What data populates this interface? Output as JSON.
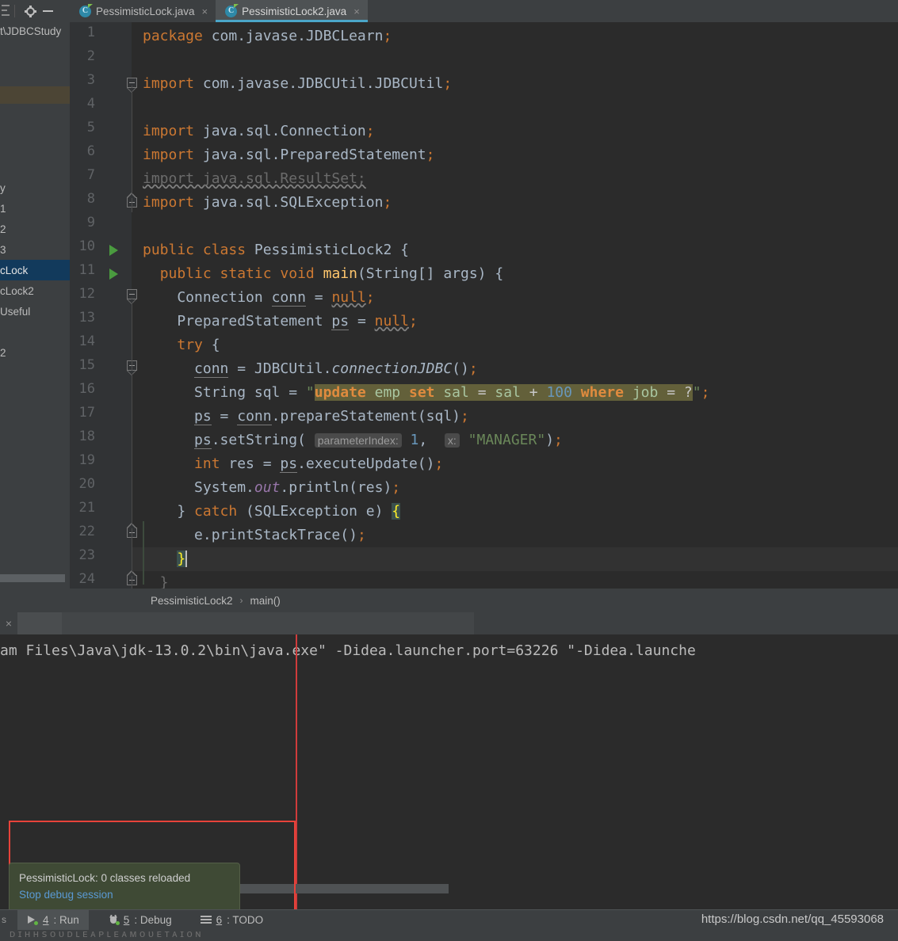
{
  "window": {
    "toolbar_icons": [
      "layout-icon",
      "gear-icon",
      "minimize-icon"
    ]
  },
  "tabs": [
    {
      "label": "PessimisticLock.java",
      "icon": "java-class-icon",
      "close": "×",
      "active": false
    },
    {
      "label": "PessimisticLock2.java",
      "icon": "java-class-icon",
      "close": "×",
      "active": true
    }
  ],
  "sidebar": {
    "path": "t\\JDBCStudy",
    "items": [
      {
        "label": "y",
        "selected": false
      },
      {
        "label": "1",
        "selected": false
      },
      {
        "label": "2",
        "selected": false
      },
      {
        "label": "3",
        "selected": false
      },
      {
        "label": "cLock",
        "selected": true
      },
      {
        "label": "cLock2",
        "selected": false
      },
      {
        "label": "Useful",
        "selected": false
      },
      {
        "label": "2",
        "selected": false
      }
    ]
  },
  "editor": {
    "caret_line": 23,
    "run_marker_lines": [
      10,
      11
    ],
    "lines": [
      {
        "n": 1,
        "text": "package com.javase.JDBCLearn;"
      },
      {
        "n": 2,
        "text": ""
      },
      {
        "n": 3,
        "text": "import com.javase.JDBCUtil.JDBCUtil;"
      },
      {
        "n": 4,
        "text": ""
      },
      {
        "n": 5,
        "text": "import java.sql.Connection;"
      },
      {
        "n": 6,
        "text": "import java.sql.PreparedStatement;"
      },
      {
        "n": 7,
        "text": "import java.sql.ResultSet;"
      },
      {
        "n": 8,
        "text": "import java.sql.SQLException;"
      },
      {
        "n": 9,
        "text": ""
      },
      {
        "n": 10,
        "text": "public class PessimisticLock2 {"
      },
      {
        "n": 11,
        "text": "  public static void main(String[] args) {"
      },
      {
        "n": 12,
        "text": "    Connection conn = null;"
      },
      {
        "n": 13,
        "text": "    PreparedStatement ps = null;"
      },
      {
        "n": 14,
        "text": "    try {"
      },
      {
        "n": 15,
        "text": "      conn = JDBCUtil.connectionJDBC();"
      },
      {
        "n": 16,
        "text": "      String sql = \"update emp set sal = sal + 100 where job = ?\";"
      },
      {
        "n": 17,
        "text": "      ps = conn.prepareStatement(sql);"
      },
      {
        "n": 18,
        "text": "      ps.setString( parameterIndex: 1,  x: \"MANAGER\");"
      },
      {
        "n": 19,
        "text": "      int res = ps.executeUpdate();"
      },
      {
        "n": 20,
        "text": "      System.out.println(res);"
      },
      {
        "n": 21,
        "text": "    } catch (SQLException e) {"
      },
      {
        "n": 22,
        "text": "      e.printStackTrace();"
      },
      {
        "n": 23,
        "text": "    }"
      },
      {
        "n": 24,
        "text": "  }"
      }
    ],
    "param_hints": [
      {
        "label": "parameterIndex:"
      },
      {
        "label": "x:"
      }
    ]
  },
  "breadcrumbs": {
    "items": [
      "PessimisticLock2",
      "main()"
    ],
    "separator": "›"
  },
  "console": {
    "close_icon": "×",
    "output": "am Files\\Java\\jdk-13.0.2\\bin\\java.exe\" -Didea.launcher.port=63226 \"-Didea.launche"
  },
  "balloon": {
    "message": "PessimisticLock: 0 classes reloaded",
    "action": "Stop debug session"
  },
  "bottom_bar": {
    "buttons": [
      {
        "num": "4",
        "label": ": Run",
        "icon": "run-icon",
        "active": true
      },
      {
        "num": "5",
        "label": ": Debug",
        "icon": "debug-icon",
        "active": false
      },
      {
        "num": "6",
        "label": ": TODO",
        "icon": "todo-icon",
        "active": false
      }
    ]
  },
  "watermark": "https://blog.csdn.net/qq_45593068",
  "colors": {
    "editor_bg": "#2b2b2b",
    "panel_bg": "#3c3f41",
    "tab_active_underline": "#4ba6c9",
    "keyword": "#cc7832",
    "string": "#6a8759",
    "number": "#6897bb",
    "method": "#ffc66d",
    "static_field": "#9876aa",
    "sql_injection_bg": "#63603a",
    "selection": "#123a5c",
    "annotation_rect": "#e8433a",
    "balloon_bg": "#3f4a35",
    "balloon_link": "#5a9ad4",
    "run_marker": "#4a9b3f"
  }
}
